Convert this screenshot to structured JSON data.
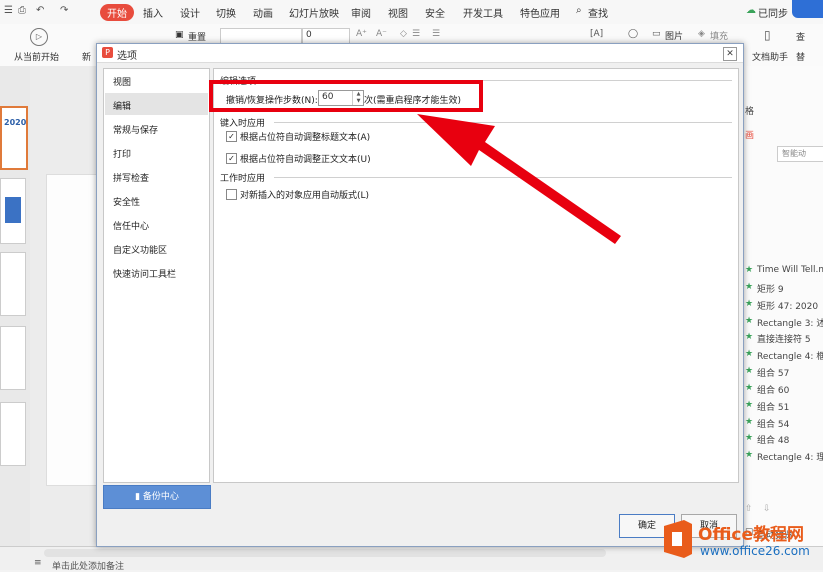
{
  "ribbon": {
    "tabs": [
      "开始",
      "插入",
      "设计",
      "切换",
      "动画",
      "幻灯片放映",
      "审阅",
      "视图",
      "安全",
      "开发工具",
      "特色应用"
    ],
    "active_tab": "开始",
    "search_label": "查找",
    "sync_label": "已同步",
    "play_from_current": "从当前开始",
    "new_slide_partial": "新",
    "reset_label": "重置",
    "font_size": "0",
    "picture_label": "图片",
    "fill_label": "填充",
    "doc_assistant": "文档助手",
    "find_partial": "查",
    "replace_partial": "替"
  },
  "right_pane": {
    "items_top": [
      "格",
      "画"
    ],
    "smart_button": "智能动",
    "objects": [
      "Time Will Tell.m",
      "矩形 9",
      "矩形 47: 2020",
      "Rectangle 3: 述",
      "直接连接符 5",
      "Rectangle 4: 框",
      "组合 57",
      "组合 60",
      "组合 51",
      "组合 54",
      "组合 48",
      "Rectangle 4: 理"
    ],
    "auto_preview": "自动预览"
  },
  "slide_thumb_text": "2020",
  "status": {
    "notes_hint": "单击此处添加备注"
  },
  "dialog": {
    "title": "选项",
    "nav": [
      "视图",
      "编辑",
      "常规与保存",
      "打印",
      "拼写检查",
      "安全性",
      "信任中心",
      "自定义功能区",
      "快速访问工具栏"
    ],
    "selected": "编辑",
    "backup_button": "备份中心",
    "groups": {
      "edit_options": "编辑选项",
      "undo_label": "撤销/恢复操作步数(N):",
      "undo_value": "60",
      "undo_suffix": "次(需重启程序才能生效)",
      "typing_group": "键入时应用",
      "auto_title": "根据占位符自动调整标题文本(A)",
      "auto_body": "根据占位符自动调整正文文本(U)",
      "working_group": "工作时应用",
      "auto_layout": "对新插入的对象应用自动版式(L)"
    },
    "ok": "确定",
    "cancel": "取消"
  },
  "watermark": {
    "brand": "Office教程网",
    "url": "www.office26.com"
  },
  "colors": {
    "accent": "#e84c3d",
    "highlight_red": "#e8000f",
    "watermark_orange": "#e95c1b",
    "watermark_blue": "#1b6fc0"
  }
}
